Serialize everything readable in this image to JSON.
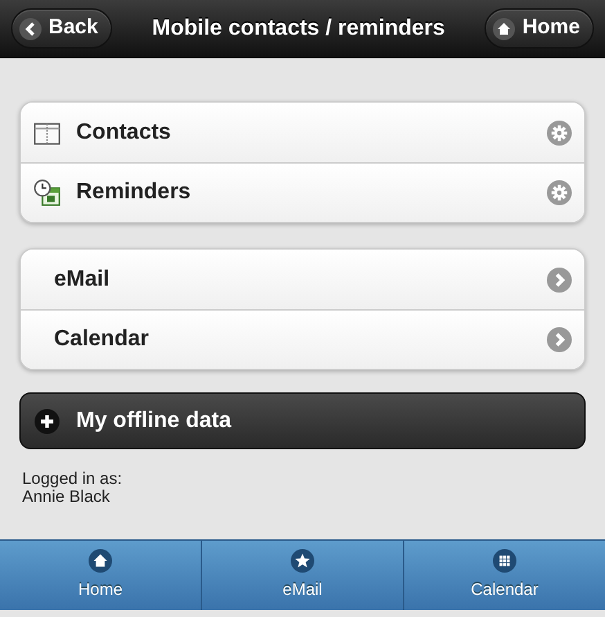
{
  "header": {
    "back": "Back",
    "title": "Mobile contacts / reminders",
    "home": "Home"
  },
  "lists": [
    {
      "kind": "settings",
      "items": [
        {
          "label": "Contacts"
        },
        {
          "label": "Reminders"
        }
      ]
    },
    {
      "kind": "link",
      "items": [
        {
          "label": "eMail"
        },
        {
          "label": "Calendar"
        }
      ]
    }
  ],
  "collapsible": {
    "label": "My offline data",
    "expanded": false
  },
  "login": {
    "label": "Logged in as:",
    "user": "Annie Black"
  },
  "navbar": [
    {
      "label": "Home"
    },
    {
      "label": "eMail"
    },
    {
      "label": "Calendar"
    }
  ]
}
